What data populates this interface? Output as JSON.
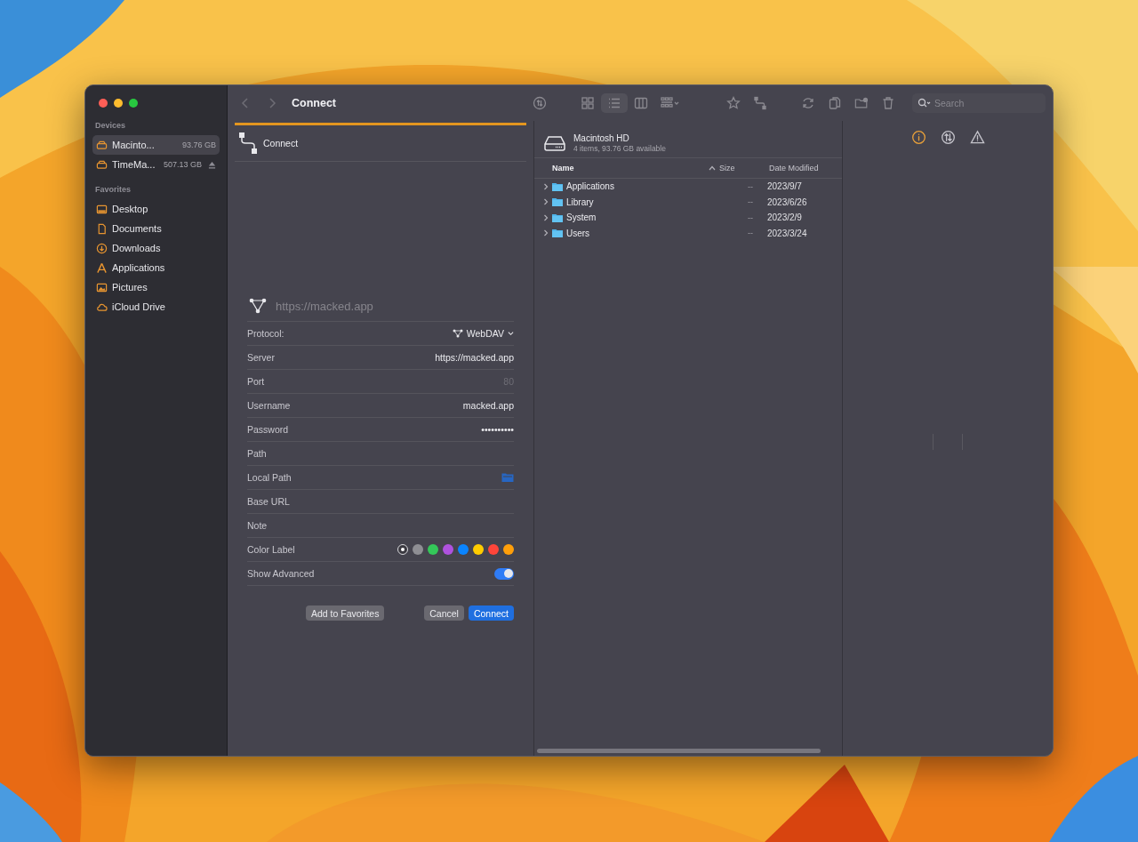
{
  "window": {
    "title": "Connect"
  },
  "sidebar": {
    "sections": [
      {
        "heading": "Devices",
        "items": [
          {
            "label": "Macinto...",
            "size": "93.76 GB",
            "kind": "drive",
            "ejectable": false,
            "selected": true
          },
          {
            "label": "TimeMa...",
            "size": "507.13 GB",
            "kind": "drive",
            "ejectable": true,
            "selected": false
          }
        ]
      },
      {
        "heading": "Favorites",
        "items": [
          {
            "label": "Desktop",
            "kind": "desktop",
            "selected": false
          },
          {
            "label": "Documents",
            "kind": "document",
            "selected": false
          },
          {
            "label": "Downloads",
            "kind": "download",
            "selected": false
          },
          {
            "label": "Applications",
            "kind": "apps",
            "selected": false
          },
          {
            "label": "Pictures",
            "kind": "pictures",
            "selected": false
          },
          {
            "label": "iCloud Drive",
            "kind": "cloud",
            "selected": false
          }
        ]
      }
    ]
  },
  "toolbar": {
    "view_modes": [
      {
        "kind": "grid",
        "selected": false
      },
      {
        "kind": "list",
        "selected": true
      },
      {
        "kind": "columns",
        "selected": false
      }
    ],
    "search": {
      "placeholder": "Search"
    }
  },
  "connect_panel": {
    "tab": "Connect",
    "progress": {
      "level": 1
    },
    "server_header": "https://macked.app",
    "fields": [
      {
        "label": "Protocol:",
        "kind": "select",
        "value": "WebDAV"
      },
      {
        "label": "Server",
        "kind": "text",
        "value": "https://macked.app"
      },
      {
        "label": "Port",
        "kind": "text",
        "placeholder": "80"
      },
      {
        "label": "Username",
        "kind": "text",
        "value": "macked.app"
      },
      {
        "label": "Password",
        "kind": "text",
        "value": "••••••••••"
      },
      {
        "label": "Path",
        "kind": "text"
      },
      {
        "label": "Local Path",
        "kind": "folder"
      },
      {
        "label": "Base URL",
        "kind": "text"
      },
      {
        "label": "Note",
        "kind": "text"
      },
      {
        "label": "Color Label",
        "kind": "colors"
      },
      {
        "label": "Show Advanced",
        "kind": "toggle",
        "on": true
      }
    ],
    "color_labels": [
      {
        "kind": "none",
        "selected": true
      },
      {
        "kind": "color",
        "color": "#8e8e93",
        "selected": false
      },
      {
        "kind": "color",
        "color": "#34c759",
        "selected": false
      },
      {
        "kind": "color",
        "color": "#af52de",
        "selected": false
      },
      {
        "kind": "color",
        "color": "#0a84ff",
        "selected": false
      },
      {
        "kind": "color",
        "color": "#ffcc00",
        "selected": false
      },
      {
        "kind": "color",
        "color": "#ff453a",
        "selected": false
      },
      {
        "kind": "color",
        "color": "#ff9f0a",
        "selected": false
      }
    ],
    "buttons": [
      {
        "label": "Add to Favorites",
        "kind": "secondary"
      },
      {
        "label": "Cancel",
        "kind": "secondary"
      },
      {
        "label": "Connect",
        "kind": "primary"
      }
    ]
  },
  "browser": {
    "volume": "Macintosh HD",
    "summary": "4 items, 93.76 GB available",
    "columns": [
      {
        "label": "Name",
        "sorted": true
      },
      {
        "label": "Size",
        "sorted": false
      },
      {
        "label": "Date Modified",
        "sorted": false
      }
    ],
    "rows": [
      {
        "name": "Applications",
        "size": "--",
        "date": "2023/9/7"
      },
      {
        "name": "Library",
        "size": "--",
        "date": "2023/6/26"
      },
      {
        "name": "System",
        "size": "--",
        "date": "2023/2/9"
      },
      {
        "name": "Users",
        "size": "--",
        "date": "2023/3/24"
      }
    ]
  },
  "inspector": {
    "tabs": [
      {
        "kind": "info",
        "selected": true
      },
      {
        "kind": "sync",
        "selected": false
      },
      {
        "kind": "warning",
        "selected": false
      }
    ]
  }
}
